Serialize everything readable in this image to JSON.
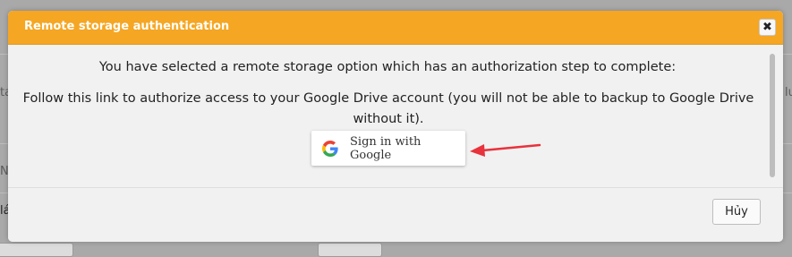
{
  "background": {
    "fragments": [
      "ta",
      "N",
      "lá",
      "lu"
    ]
  },
  "dialog": {
    "title": "Remote storage authentication",
    "close_glyph": "✖",
    "message_line1": "You have selected a remote storage option which has an authorization step to complete:",
    "message_line2": "Follow this link to authorize access to your Google Drive account (you will not be able to backup to Google Drive without it).",
    "google_button_label": "Sign in with Google",
    "google_icon": "google-g-icon",
    "arrow_color": "#e8323c",
    "cancel_label": "Hủy"
  },
  "colors": {
    "titlebar": "#f5a623",
    "overlay": "#a9a9a9"
  }
}
